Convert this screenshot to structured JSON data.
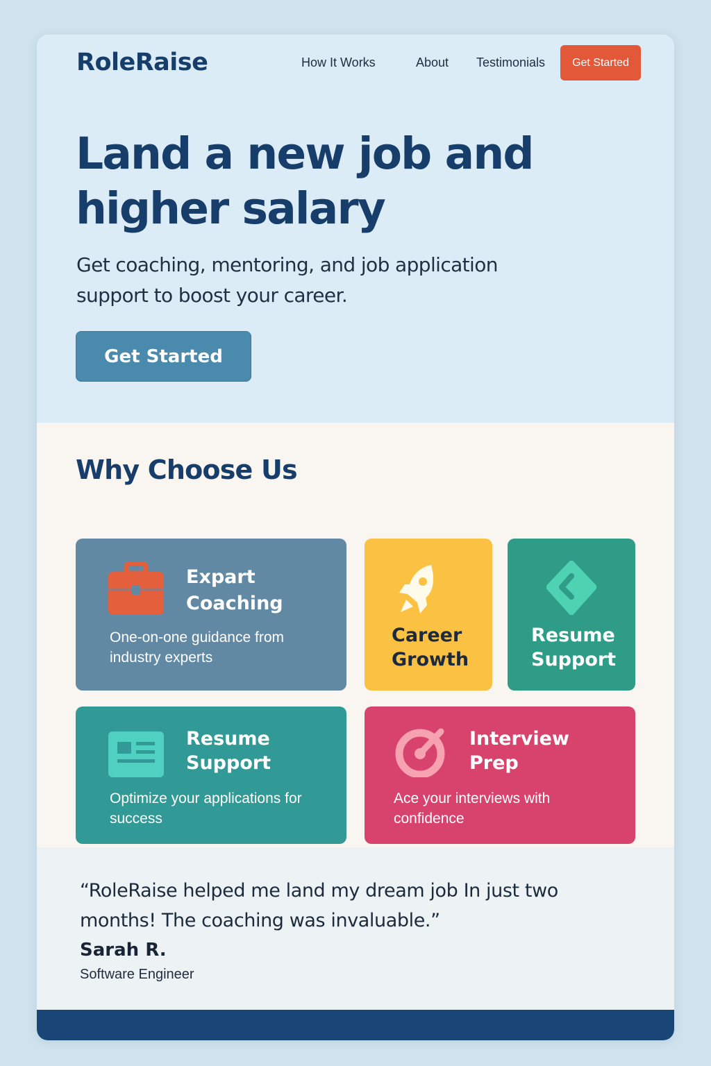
{
  "brand": {
    "name": "RoleRaise"
  },
  "nav": {
    "links": [
      "How It Works",
      "About",
      "Testimonials"
    ],
    "cta_label": "Get Started"
  },
  "hero": {
    "title": "Land a new job and higher salary",
    "subtitle": "Get coaching, mentoring, and job application support to boost your career.",
    "cta_label": "Get Started"
  },
  "features": {
    "title": "Why Choose Us",
    "cards": [
      {
        "title": "Expart Coaching",
        "desc": "One-on-one guidance from industry experts",
        "icon": "briefcase-icon",
        "color": "#6189a4"
      },
      {
        "title": "Career Growth",
        "desc": "",
        "icon": "rocket-icon",
        "color": "#fbc143"
      },
      {
        "title": "Resume Support",
        "desc": "",
        "icon": "diamond-icon",
        "color": "#2e9c86"
      },
      {
        "title": "Resume Support",
        "desc": "Optimize your applications for success",
        "icon": "document-icon",
        "color": "#319a96"
      },
      {
        "title": "Interview Prep",
        "desc": "Ace your interviews with confidence",
        "icon": "target-icon",
        "color": "#d8436e"
      }
    ]
  },
  "testimonial": {
    "quote": "“RoleRaise helped me land my dream job In just two months! The coaching was invaluable.”",
    "author": "Sarah R.",
    "role": "Software Engineer"
  },
  "colors": {
    "brand": "#173d6a",
    "accent": "#e4583a",
    "primary_button": "#4a8aad",
    "footer": "#1a4677"
  }
}
